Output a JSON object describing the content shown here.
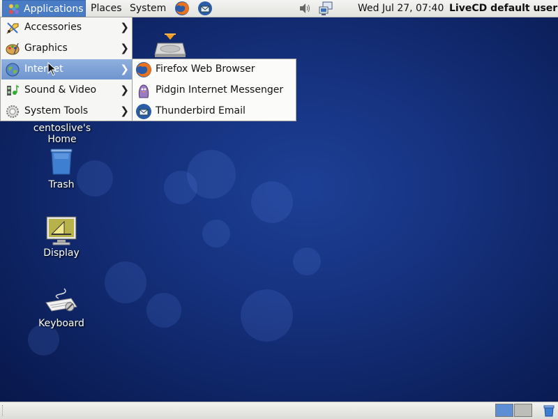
{
  "top_panel": {
    "menus": [
      "Applications",
      "Places",
      "System"
    ],
    "launchers": [
      "firefox-icon",
      "thunderbird-icon"
    ],
    "tray_icons": [
      "volume-icon",
      "network-icon"
    ],
    "clock": "Wed Jul 27, 07:40",
    "user": "LiveCD default user"
  },
  "applications_menu": {
    "items": [
      {
        "label": "Accessories",
        "icon": "accessories-icon"
      },
      {
        "label": "Graphics",
        "icon": "graphics-icon"
      },
      {
        "label": "Internet",
        "icon": "internet-globe-icon"
      },
      {
        "label": "Sound & Video",
        "icon": "sound-video-icon"
      },
      {
        "label": "System Tools",
        "icon": "system-tools-icon"
      }
    ],
    "highlighted": "Internet"
  },
  "internet_submenu": {
    "items": [
      {
        "label": "Firefox Web Browser",
        "icon": "firefox-icon"
      },
      {
        "label": "Pidgin Internet Messenger",
        "icon": "pidgin-icon"
      },
      {
        "label": "Thunderbird Email",
        "icon": "thunderbird-icon"
      }
    ]
  },
  "desktop_icons": [
    {
      "label": "centoslive's Home",
      "icon": "home-folder-icon"
    },
    {
      "label": "Trash",
      "icon": "trash-icon"
    },
    {
      "label": "Display",
      "icon": "display-icon"
    },
    {
      "label": "Keyboard",
      "icon": "keyboard-icon"
    }
  ],
  "colors": {
    "menu_highlight": "#7a9fd4",
    "desktop_bg": "#16327f"
  }
}
